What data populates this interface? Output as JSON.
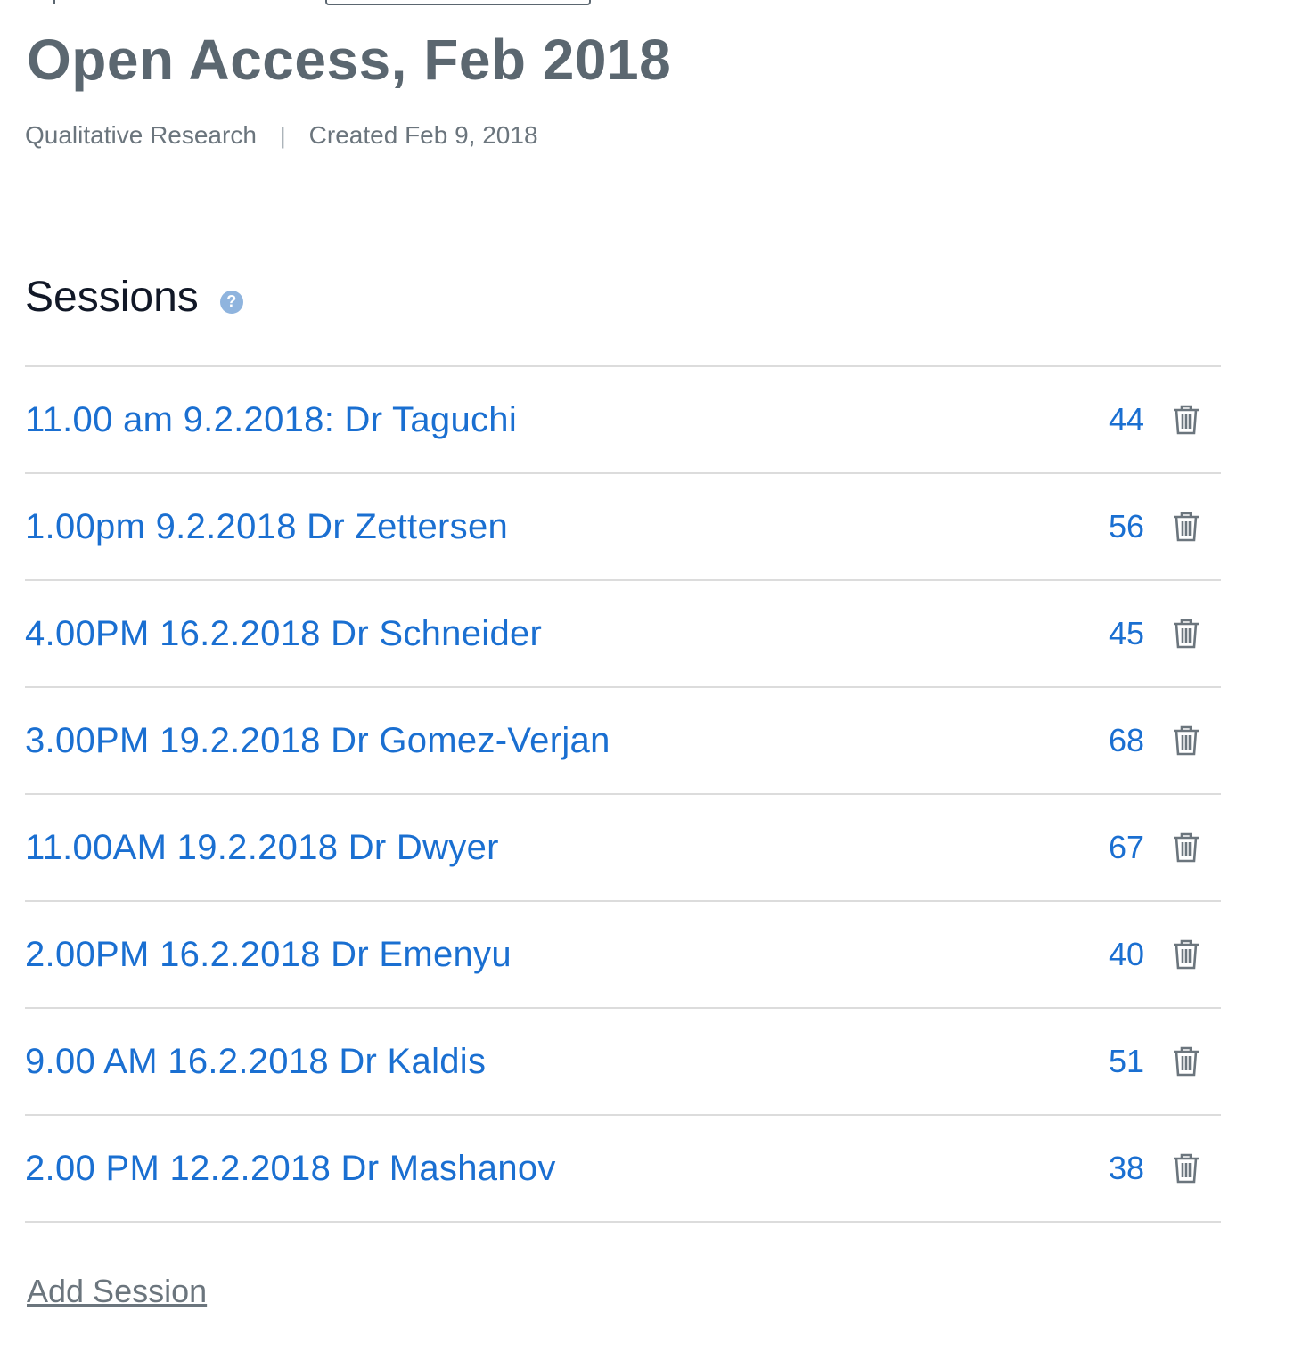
{
  "header": {
    "title": "Open Access, Feb 2018",
    "category": "Qualitative Research",
    "separator": "|",
    "created": "Created Feb 9, 2018"
  },
  "sessions": {
    "title": "Sessions",
    "help_icon": "question-circle-icon",
    "help_glyph": "?",
    "items": [
      {
        "name": "11.00 am 9.2.2018: Dr Taguchi",
        "count": "44"
      },
      {
        "name": "1.00pm 9.2.2018 Dr Zettersen",
        "count": "56"
      },
      {
        "name": "4.00PM 16.2.2018 Dr Schneider",
        "count": "45"
      },
      {
        "name": "3.00PM 19.2.2018 Dr Gomez-Verjan",
        "count": "68"
      },
      {
        "name": "11.00AM 19.2.2018 Dr Dwyer",
        "count": "67"
      },
      {
        "name": "2.00PM 16.2.2018 Dr Emenyu",
        "count": "40"
      },
      {
        "name": "9.00 AM 16.2.2018 Dr Kaldis",
        "count": "51"
      },
      {
        "name": "2.00 PM 12.2.2018 Dr Mashanov",
        "count": "38"
      }
    ],
    "delete_icon": "trash-icon",
    "add_label": "Add Session"
  },
  "colors": {
    "title": "#5b6770",
    "link": "#1a6fd1",
    "divider": "#dcdcdc",
    "muted": "#6b757d",
    "help": "#8fb4de"
  }
}
